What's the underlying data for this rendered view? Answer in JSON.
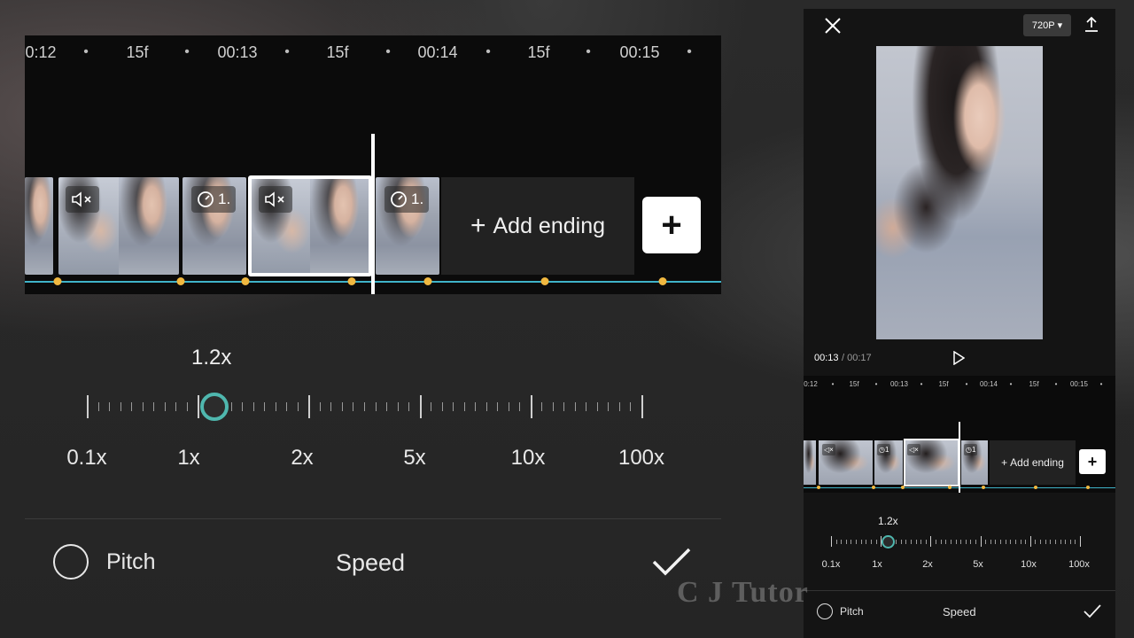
{
  "timeline": {
    "ruler_labels": [
      "0:12",
      "15f",
      "00:13",
      "15f",
      "00:14",
      "15f",
      "00:15"
    ],
    "clip_badge_mute": "🔇",
    "clip_badge_speed": "1.",
    "add_ending_label": "Add ending",
    "plus_label": "+"
  },
  "speed_panel": {
    "current_value": "1.2x",
    "slider_labels": [
      "0.1x",
      "1x",
      "2x",
      "5x",
      "10x",
      "100x"
    ],
    "selected_speed": 1.2,
    "pitch_label": "Pitch",
    "pitch_enabled": false,
    "title": "Speed"
  },
  "preview_panel": {
    "resolution": "720P",
    "time_current": "00:13",
    "time_total": "/ 00:17",
    "ruler_labels": [
      "0:12",
      "15f",
      "00:13",
      "15f",
      "00:14",
      "15f",
      "00:15"
    ]
  },
  "watermark": "C J Tutor",
  "colors": {
    "accent_teal": "#4fb7ae",
    "track_line": "#3fb3c8",
    "keyframe_dot": "#f0b840"
  }
}
